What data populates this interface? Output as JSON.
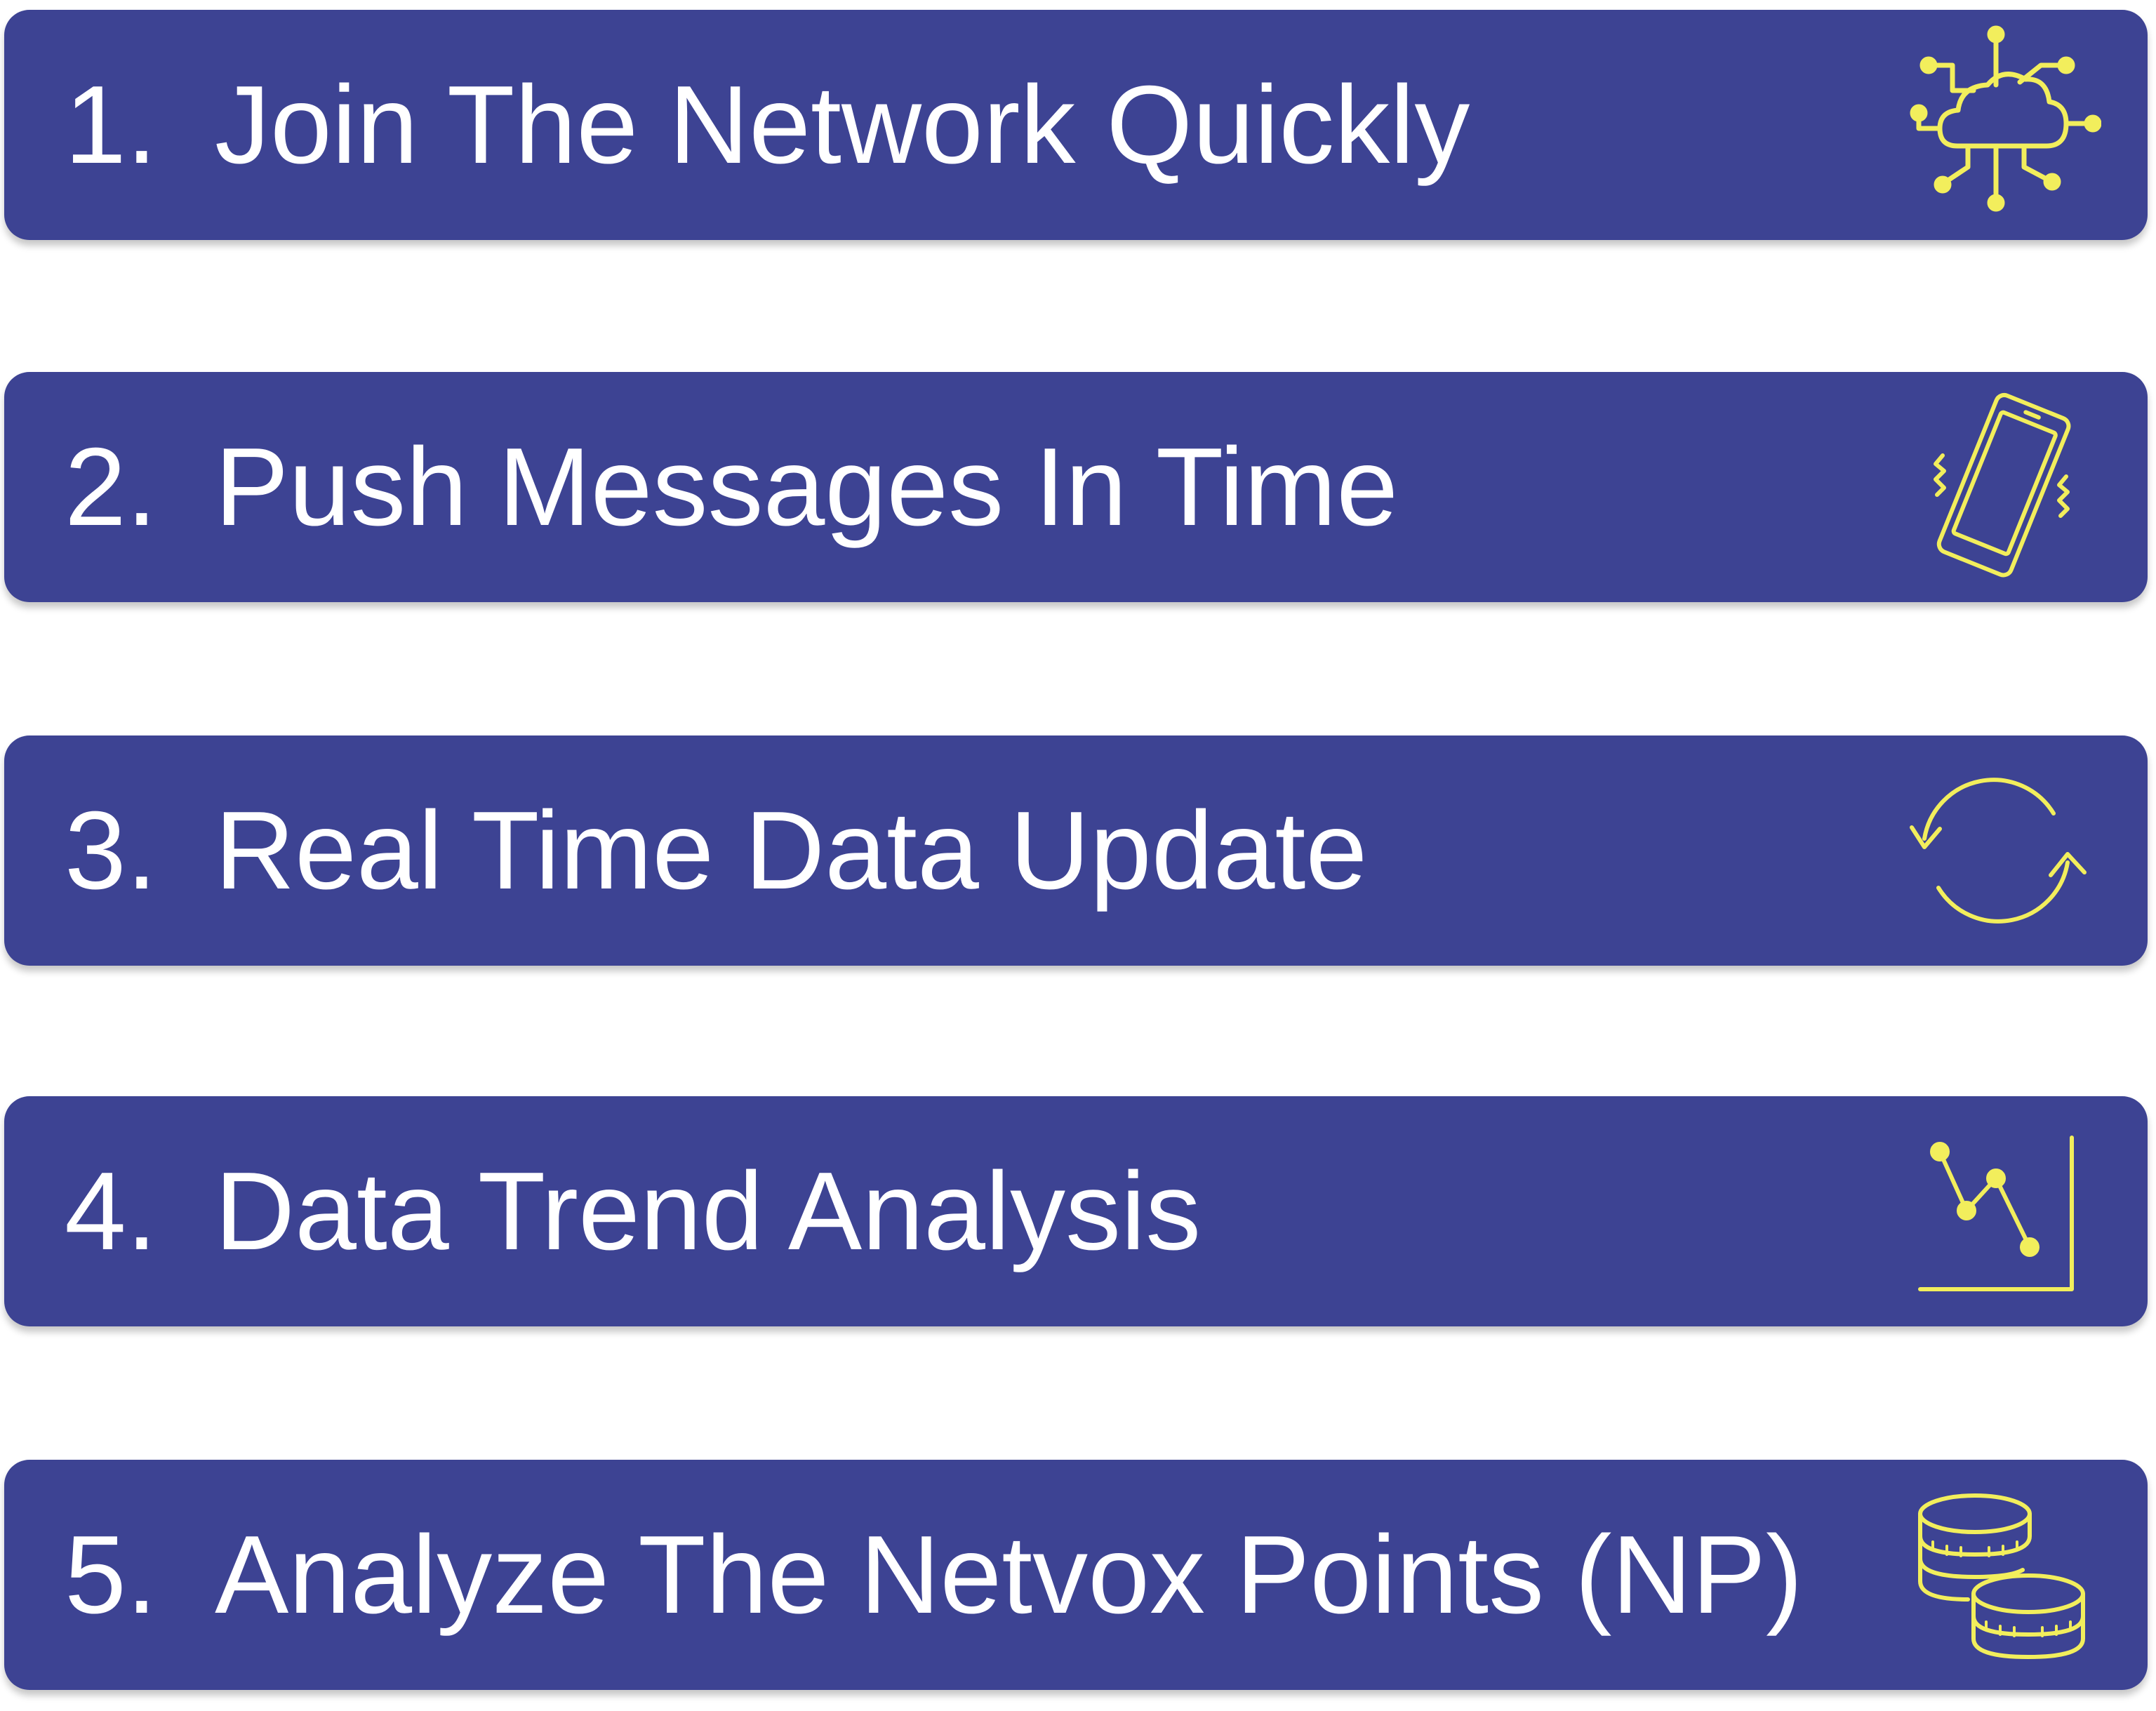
{
  "features": [
    {
      "number": "1.",
      "label": "Join The Network Quickly",
      "icon": "cloud-network-icon"
    },
    {
      "number": "2.",
      "label": "Push Messages In Time",
      "icon": "vibrating-phone-icon"
    },
    {
      "number": "3.",
      "label": "Real Time Data Update",
      "icon": "refresh-icon"
    },
    {
      "number": "4.",
      "label": "Data Trend Analysis",
      "icon": "trend-chart-icon"
    },
    {
      "number": "5.",
      "label": "Analyze The Netvox Points (NP)",
      "icon": "coins-icon"
    }
  ],
  "colors": {
    "bar_background": "#3d4393",
    "text": "#ffffff",
    "icon_stroke": "#f2ee5c",
    "page_background": "#ffffff"
  }
}
